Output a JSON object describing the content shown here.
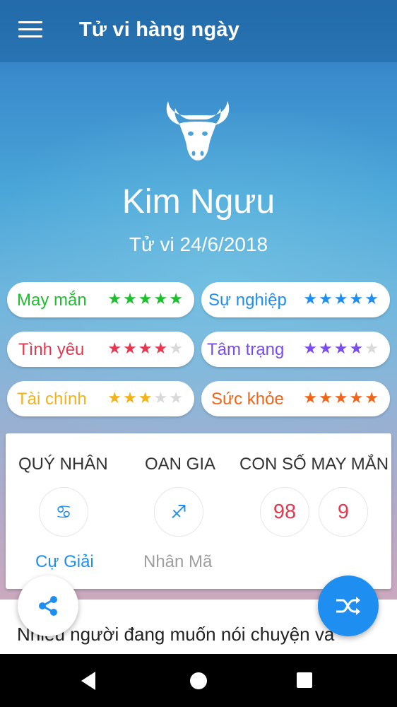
{
  "header": {
    "title": "Tử vi hàng ngày"
  },
  "sign": {
    "name": "Kim Ngưu",
    "date": "Tử vi 24/6/2018"
  },
  "ratings": [
    {
      "label": "May mắn",
      "stars": 5,
      "color": "#1fbe2f"
    },
    {
      "label": "Sự nghiệp",
      "stars": 5,
      "color": "#1e8ff0"
    },
    {
      "label": "Tình yêu",
      "stars": 4,
      "color": "#e5384f"
    },
    {
      "label": "Tâm trạng",
      "stars": 4,
      "color": "#7a4cf0"
    },
    {
      "label": "Tài chính",
      "stars": 3,
      "color": "#f3b21a"
    },
    {
      "label": "Sức khỏe",
      "stars": 5,
      "color": "#f26417"
    }
  ],
  "info": {
    "guardian": {
      "title": "QUÝ NHÂN",
      "sign": "Cự Giải",
      "symbol": "♋",
      "color": "#1e8ff0"
    },
    "enemy": {
      "title": "OAN GIA",
      "sign": "Nhân Mã",
      "symbol": "♐",
      "color": "#9e9e9e"
    },
    "lucky": {
      "title": "CON SỐ MAY MẮN",
      "numbers": [
        "98",
        "9"
      ]
    }
  },
  "body": {
    "text": "Nhiều người đang muốn nói chuyện và"
  },
  "icons": {
    "menu": "menu-icon",
    "bull": "taurus-bull-icon",
    "share": "share-icon",
    "shuffle": "shuffle-icon",
    "back": "back-icon",
    "home": "home-icon",
    "recents": "recents-icon"
  },
  "colors": {
    "accent": "#1e8ff0",
    "number": "#e53950"
  }
}
